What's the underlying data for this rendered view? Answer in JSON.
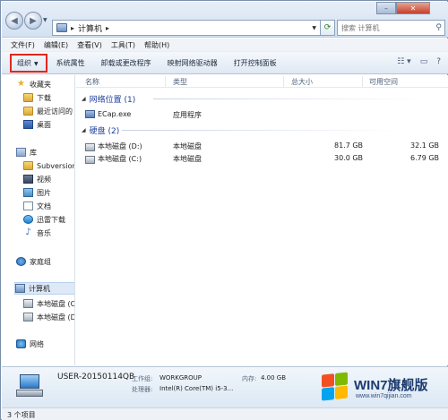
{
  "address_bar": {
    "path_icon": "computer-icon",
    "path": "计算机",
    "search_placeholder": "搜索 计算机"
  },
  "menu": [
    "文件(F)",
    "编辑(E)",
    "查看(V)",
    "工具(T)",
    "帮助(H)"
  ],
  "toolbar": {
    "organize": "组织",
    "items": [
      "系统属性",
      "卸载或更改程序",
      "映射网络驱动器",
      "打开控制面板"
    ]
  },
  "sidebar": {
    "favorites": "收藏夹",
    "favorites_items": [
      "下载",
      "最近访问的",
      "桌面"
    ],
    "libraries": "库",
    "library_items": [
      "Subversion",
      "视频",
      "图片",
      "文档",
      "迅雷下载",
      "音乐"
    ],
    "homegroup": "家庭组",
    "computer": "计算机",
    "computer_items": [
      "本地磁盘 (C",
      "本地磁盘 (D"
    ],
    "network": "网络"
  },
  "columns": [
    "名称",
    "类型",
    "总大小",
    "可用空间"
  ],
  "groups": [
    {
      "title": "网络位置 (1)",
      "rows": [
        {
          "name": "ECap.exe",
          "type": "应用程序",
          "total": "",
          "free": ""
        }
      ]
    },
    {
      "title": "硬盘 (2)",
      "rows": [
        {
          "name": "本地磁盘 (D:)",
          "type": "本地磁盘",
          "total": "81.7 GB",
          "free": "32.1 GB"
        },
        {
          "name": "本地磁盘 (C:)",
          "type": "本地磁盘",
          "total": "30.0 GB",
          "free": "6.79 GB"
        }
      ]
    }
  ],
  "details": {
    "hostname": "USER-20150114QB",
    "workgroup_label": "工作组:",
    "workgroup": "WORKGROUP",
    "memory_label": "内存:",
    "memory": "4.00 GB",
    "cpu_label": "处理器:",
    "cpu": "Intel(R) Core(TM) i5-3..."
  },
  "status": "3 个项目",
  "watermark": {
    "brand": "WIN7旗舰版",
    "url": "www.win7qijian.com"
  }
}
